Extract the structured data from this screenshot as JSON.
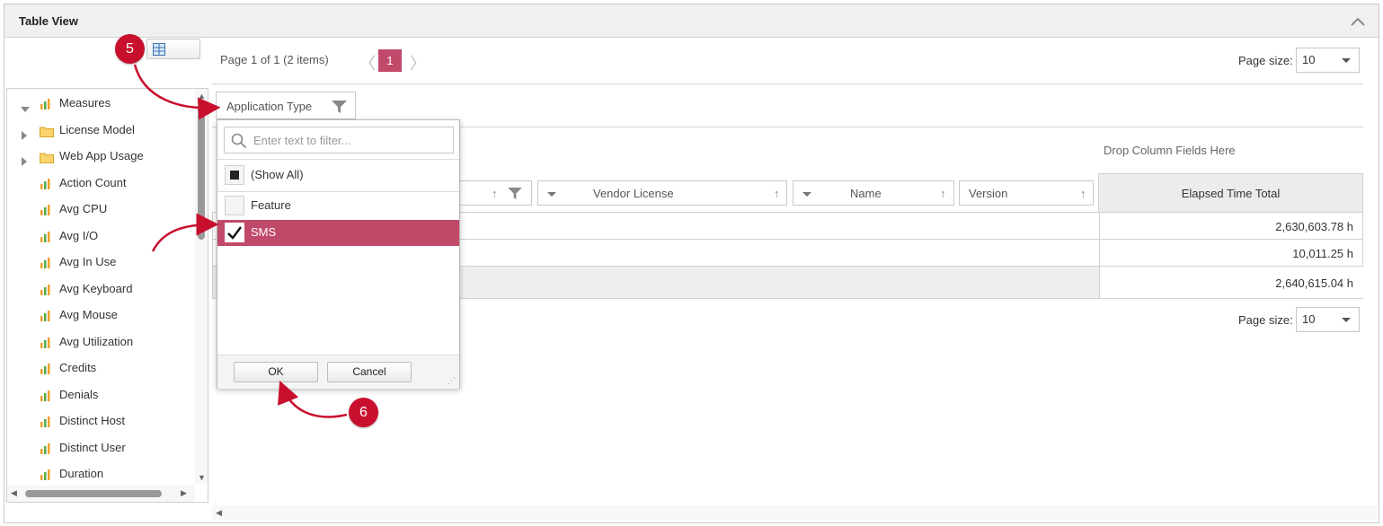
{
  "panel": {
    "title": "Table View"
  },
  "badges": {
    "step5": "5",
    "step6": "6"
  },
  "tree": {
    "items": [
      {
        "label": "Measures",
        "kind": "measure",
        "expander": "down"
      },
      {
        "label": "License Model",
        "kind": "folder",
        "expander": "right"
      },
      {
        "label": "Web App Usage",
        "kind": "folder",
        "expander": "right"
      },
      {
        "label": "Action Count",
        "kind": "measure",
        "expander": ""
      },
      {
        "label": "Avg CPU",
        "kind": "measure",
        "expander": ""
      },
      {
        "label": "Avg I/O",
        "kind": "measure",
        "expander": ""
      },
      {
        "label": "Avg In Use",
        "kind": "measure",
        "expander": ""
      },
      {
        "label": "Avg Keyboard",
        "kind": "measure",
        "expander": ""
      },
      {
        "label": "Avg Mouse",
        "kind": "measure",
        "expander": ""
      },
      {
        "label": "Avg Utilization",
        "kind": "measure",
        "expander": ""
      },
      {
        "label": "Credits",
        "kind": "measure",
        "expander": ""
      },
      {
        "label": "Denials",
        "kind": "measure",
        "expander": ""
      },
      {
        "label": "Distinct Host",
        "kind": "measure",
        "expander": ""
      },
      {
        "label": "Distinct User",
        "kind": "measure",
        "expander": ""
      },
      {
        "label": "Duration",
        "kind": "measure",
        "expander": ""
      }
    ]
  },
  "pager": {
    "summary": "Page 1 of 1 (2 items)",
    "current_page": "1",
    "page_size_label": "Page size:",
    "page_size_value": "10"
  },
  "filter_area": {
    "field_label": "Application Type",
    "drop_hint": "Drop Column Fields Here"
  },
  "columns": [
    {
      "label": "Vendor License"
    },
    {
      "label": "Name"
    },
    {
      "label": "Version"
    }
  ],
  "grid": {
    "data_header": "Elapsed Time Total",
    "values": [
      "2,630,603.78 h",
      "10,011.25 h",
      "2,640,615.04 h"
    ]
  },
  "popup": {
    "search_placeholder": "Enter text to filter...",
    "options": [
      {
        "label": "(Show All)",
        "state": "partial"
      },
      {
        "label": "Feature",
        "state": "unchecked"
      },
      {
        "label": "SMS",
        "state": "checked"
      }
    ],
    "ok_label": "OK",
    "cancel_label": "Cancel"
  },
  "colors": {
    "accent": "#c1496a",
    "badge": "#c8102e",
    "arrow": "#c8102e"
  }
}
